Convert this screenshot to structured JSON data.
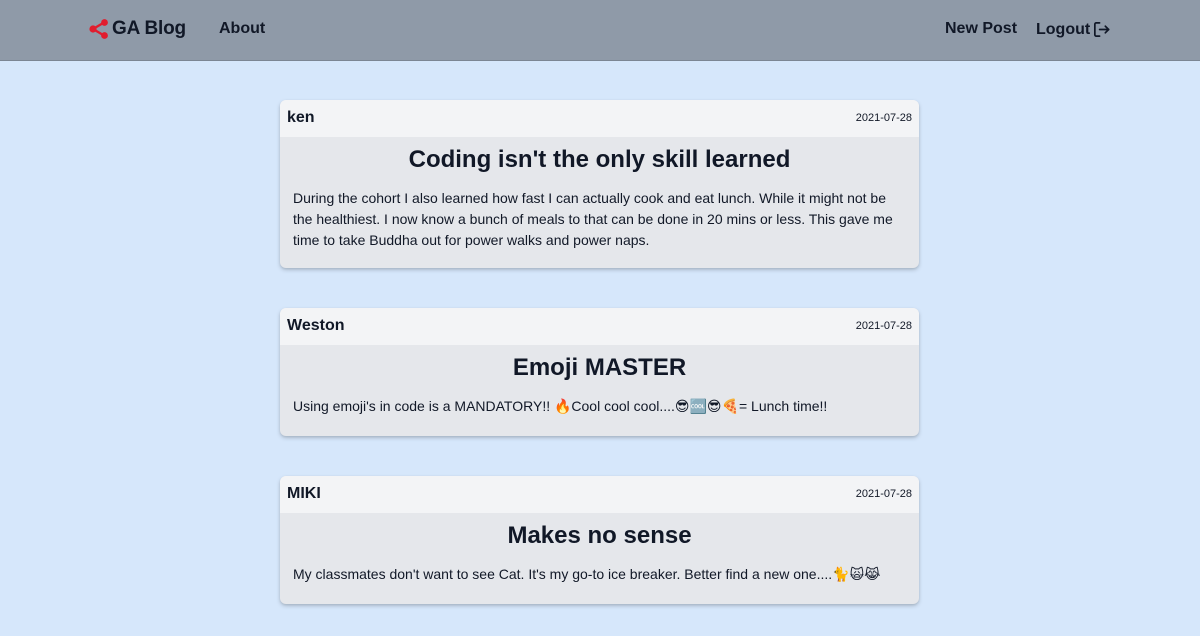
{
  "nav": {
    "brand": "GA Blog",
    "about": "About",
    "new_post": "New Post",
    "logout": "Logout"
  },
  "posts": [
    {
      "author": "ken",
      "date": "2021-07-28",
      "title": "Coding isn't the only skill learned",
      "body": "During the cohort I also learned how fast I can actually cook and eat lunch. While it might not be the healthiest. I now know a bunch of meals to that can be done in 20 mins or less. This gave me time to take Buddha out for power walks and power naps."
    },
    {
      "author": "Weston",
      "date": "2021-07-28",
      "title": "Emoji MASTER",
      "body": "Using emoji's in code is a MANDATORY!! 🔥Cool cool cool....😎🆒😎🍕= Lunch time!!"
    },
    {
      "author": "MIKI",
      "date": "2021-07-28",
      "title": "Makes no sense",
      "body": "My classmates don't want to see Cat. It's my go-to ice breaker. Better find a new one....🐈🙀😹"
    }
  ],
  "colors": {
    "page_background": "#d6e7fb",
    "navbar": "#8f9aa8",
    "brand_icon": "#e11d2e",
    "card_body": "#e5e7eb",
    "card_header": "#f3f4f6"
  },
  "icons": {
    "brand": "share-nodes-icon",
    "logout": "logout-arrow-icon"
  }
}
